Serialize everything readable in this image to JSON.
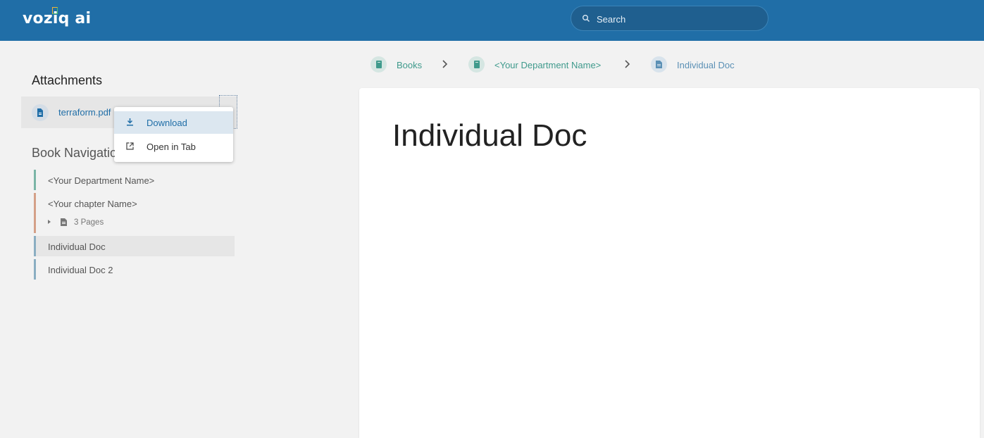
{
  "header": {
    "logo_text": "voziq ai",
    "search_placeholder": "Search",
    "bg_color": "#206ea7"
  },
  "attachments": {
    "title": "Attachments",
    "items": [
      {
        "name": "terraform.pdf",
        "icon": "file-icon"
      }
    ],
    "menu": [
      {
        "label": "Download",
        "icon": "download-icon",
        "active": true
      },
      {
        "label": "Open in Tab",
        "icon": "external-link-icon",
        "active": false
      }
    ]
  },
  "book_navigation": {
    "title": "Book Navigation",
    "items": [
      {
        "label": "<Your Department Name>",
        "accent": "#7ab5a6"
      },
      {
        "label": "<Your chapter Name>",
        "accent": "#d4a088",
        "pages_label": "3 Pages"
      },
      {
        "label": "Individual Doc",
        "accent": "#8aaec2",
        "selected": true
      },
      {
        "label": "Individual Doc 2",
        "accent": "#8aaec2"
      }
    ]
  },
  "breadcrumb": [
    {
      "label": "Books",
      "icon": "book-icon"
    },
    {
      "label": "<Your Department Name>",
      "icon": "bookshelf-icon"
    },
    {
      "label": "Individual Doc",
      "icon": "page-icon"
    }
  ],
  "document": {
    "title": "Individual Doc"
  }
}
